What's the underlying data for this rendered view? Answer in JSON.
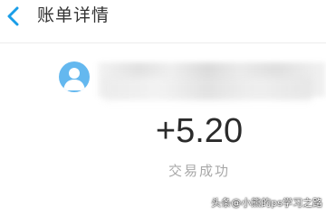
{
  "header": {
    "title": "账单详情",
    "back_icon": "chevron-left-icon",
    "accent_color": "#1a9ee8"
  },
  "payer": {
    "avatar_icon": "user-avatar-icon",
    "avatar_color": "#64b8ef",
    "name_obscured": true
  },
  "transaction": {
    "amount": "+5.20",
    "status": "交易成功"
  },
  "watermark": {
    "text": "头条@小熊的ps学习之路"
  }
}
